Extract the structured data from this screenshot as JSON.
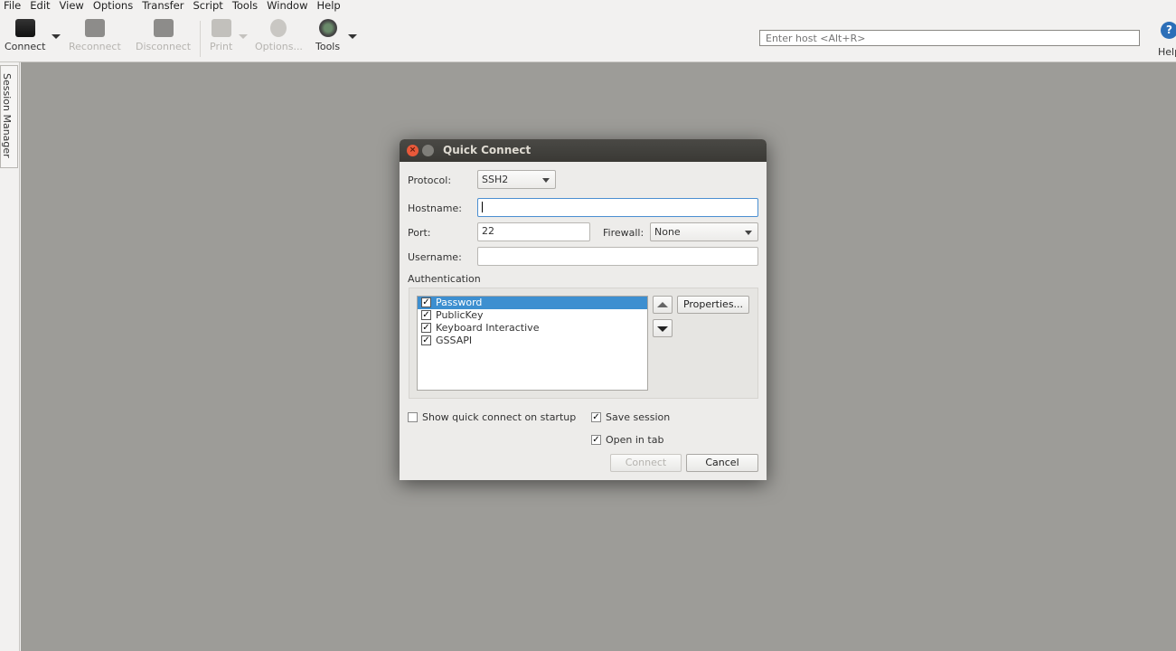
{
  "menu": [
    "File",
    "Edit",
    "View",
    "Options",
    "Transfer",
    "Script",
    "Tools",
    "Window",
    "Help"
  ],
  "toolbar": {
    "connect": "Connect",
    "reconnect": "Reconnect",
    "disconnect": "Disconnect",
    "print": "Print",
    "options": "Options...",
    "tools": "Tools",
    "help": "Help",
    "host_placeholder": "Enter host <Alt+R>"
  },
  "sidebar": {
    "session_manager": "Session Manager"
  },
  "dialog": {
    "title": "Quick Connect",
    "protocol_label": "Protocol:",
    "protocol_value": "SSH2",
    "hostname_label": "Hostname:",
    "hostname_value": "",
    "port_label": "Port:",
    "port_value": "22",
    "firewall_label": "Firewall:",
    "firewall_value": "None",
    "username_label": "Username:",
    "username_value": "",
    "auth_label": "Authentication",
    "auth_methods": [
      {
        "label": "Password",
        "checked": true,
        "selected": true
      },
      {
        "label": "PublicKey",
        "checked": true
      },
      {
        "label": "Keyboard Interactive",
        "checked": true
      },
      {
        "label": "GSSAPI",
        "checked": true
      }
    ],
    "properties": "Properties...",
    "show_on_startup": "Show quick connect on startup",
    "show_on_startup_checked": false,
    "save_session": "Save session",
    "save_session_checked": true,
    "open_in_tab": "Open in tab",
    "open_in_tab_checked": true,
    "connect": "Connect",
    "cancel": "Cancel"
  },
  "colors": {
    "selection": "#3d8fd0",
    "titlebar": "#3c3b37",
    "workspace": "#9d9c98"
  }
}
